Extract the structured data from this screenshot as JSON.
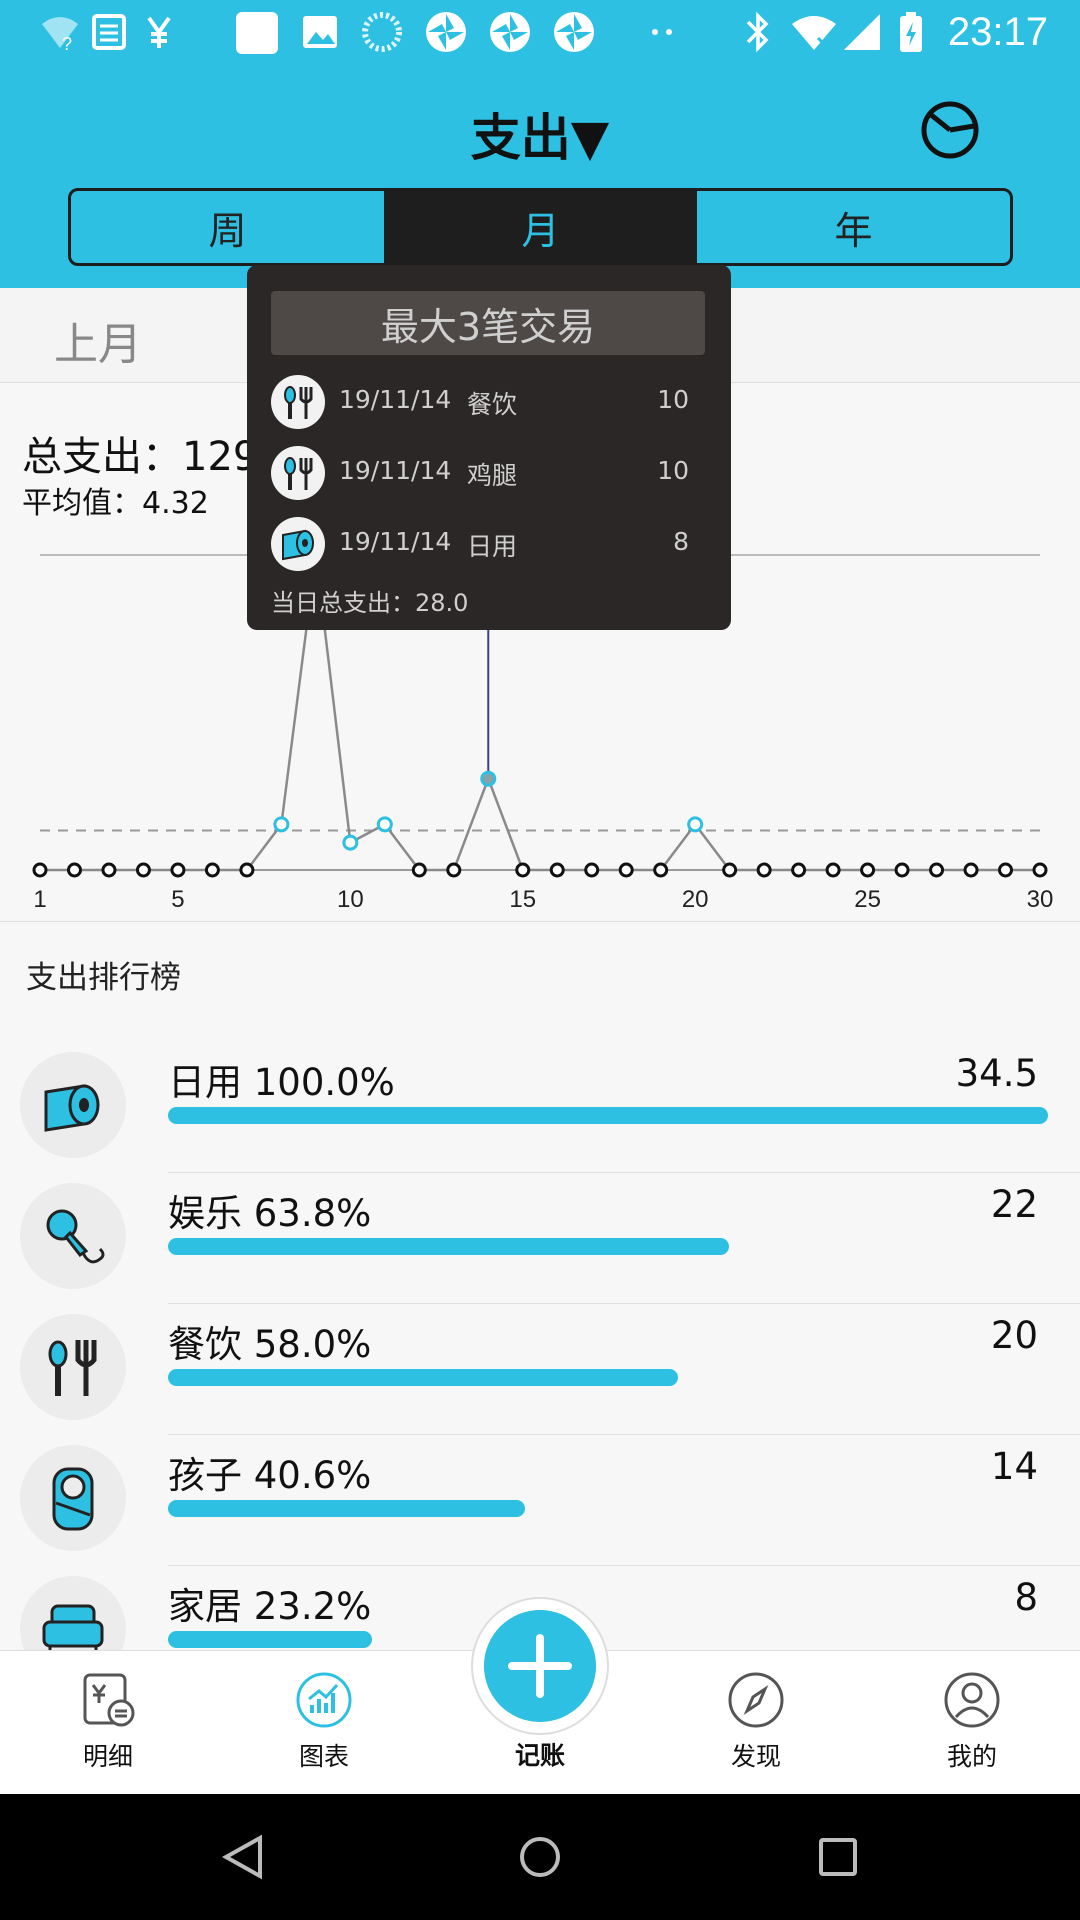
{
  "status_bar": {
    "time": "23:17",
    "icons": [
      "wifi-question-icon",
      "news-icon",
      "yen-icon",
      "blank-square-icon",
      "image-icon",
      "loading-icon",
      "app-icon",
      "app-icon",
      "app-icon",
      "dots-icon",
      "bluetooth-icon",
      "wifi-x-icon",
      "signal-icon",
      "battery-charging-icon"
    ]
  },
  "header": {
    "title": "支出▼",
    "pie_icon": "pie-chart-icon",
    "tabs": [
      {
        "label": "周",
        "active": false
      },
      {
        "label": "月",
        "active": true
      },
      {
        "label": "年",
        "active": false
      }
    ]
  },
  "month_bar": {
    "label": "上月"
  },
  "stats": {
    "total": "总支出：129.",
    "average": "平均值：4.32"
  },
  "chart_data": {
    "type": "line",
    "x": [
      1,
      2,
      3,
      4,
      5,
      6,
      7,
      8,
      9,
      10,
      11,
      12,
      13,
      14,
      15,
      16,
      17,
      18,
      19,
      20,
      21,
      22,
      23,
      24,
      25,
      26,
      27,
      28,
      29,
      30
    ],
    "values": [
      0,
      0,
      0,
      0,
      0,
      0,
      0,
      5,
      34.5,
      3,
      5,
      0,
      0,
      10,
      0,
      0,
      0,
      0,
      0,
      5,
      0,
      0,
      0,
      0,
      0,
      0,
      0,
      0,
      0,
      0
    ],
    "xticks": [
      "1",
      "5",
      "10",
      "15",
      "20",
      "25",
      "30"
    ],
    "average": 4.32,
    "max_line": 34.5,
    "highlight_day": 14,
    "colors": {
      "line": "#8a8a8a",
      "point_active": "#2ec0e2",
      "point_zero": "#111111",
      "avg_line": "#9a9a9a",
      "cursor": "#3d3f8c"
    }
  },
  "tooltip": {
    "title": "最大3笔交易",
    "rows": [
      {
        "icon": "fork-spoon-icon",
        "date": "19/11/14",
        "category": "餐饮",
        "amount": "10"
      },
      {
        "icon": "fork-spoon-icon",
        "date": "19/11/14",
        "category": "鸡腿",
        "amount": "10"
      },
      {
        "icon": "toilet-paper-icon",
        "date": "19/11/14",
        "category": "日用",
        "amount": "8"
      }
    ],
    "day_total": "当日总支出：28.0"
  },
  "ranking": {
    "title": "支出排行榜",
    "items": [
      {
        "icon": "toilet-paper-icon",
        "label": "日用 100.0%",
        "amount": "34.5",
        "share": 1.0
      },
      {
        "icon": "microphone-icon",
        "label": "娱乐 63.8%",
        "amount": "22",
        "share": 0.638
      },
      {
        "icon": "fork-spoon-icon",
        "label": "餐饮 58.0%",
        "amount": "20",
        "share": 0.58
      },
      {
        "icon": "baby-icon",
        "label": "孩子 40.6%",
        "amount": "14",
        "share": 0.406
      },
      {
        "icon": "armchair-icon",
        "label": "家居 23.2%",
        "amount": "8",
        "share": 0.232
      }
    ]
  },
  "nav": {
    "items": [
      {
        "label": "明细",
        "icon": "ledger-icon"
      },
      {
        "label": "图表",
        "icon": "chart-icon",
        "active": true
      },
      {
        "label": "记账",
        "icon": "plus-icon"
      },
      {
        "label": "发现",
        "icon": "compass-icon"
      },
      {
        "label": "我的",
        "icon": "user-icon"
      }
    ]
  },
  "system_nav": [
    "back-icon",
    "home-icon",
    "recents-icon"
  ],
  "theme": {
    "accent": "#2ec0e2",
    "dark": "#1e1e1e"
  }
}
